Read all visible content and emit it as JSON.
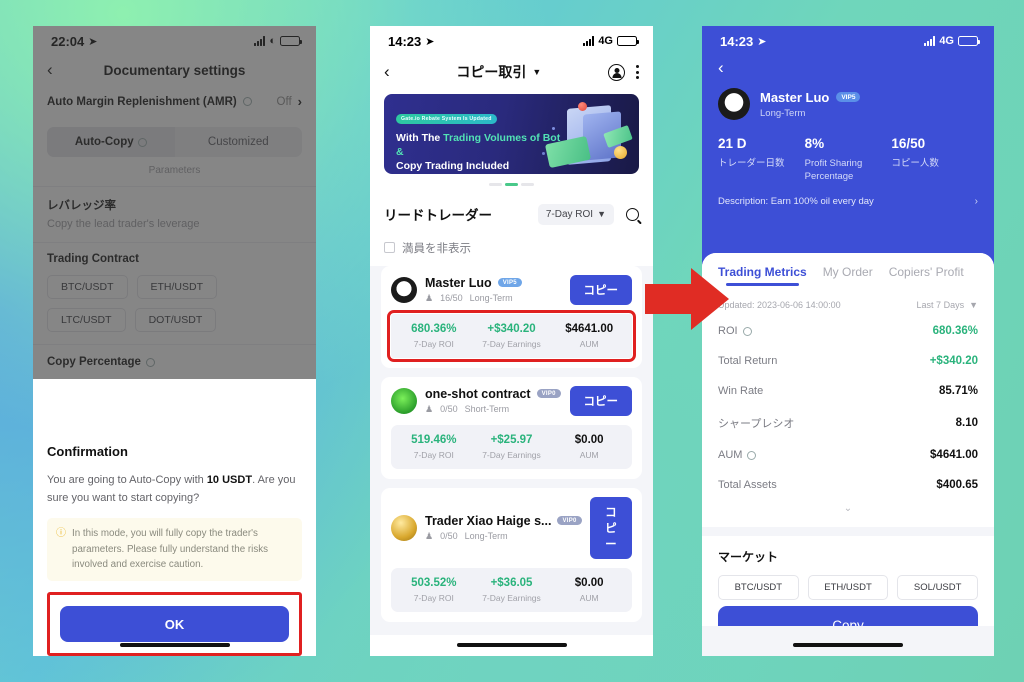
{
  "phone1": {
    "status": {
      "time": "22:04",
      "location_icon": "location-arrow",
      "network_icon": "signal-bars",
      "wifi_icon": "wifi",
      "battery_icon": "battery"
    },
    "nav": {
      "back_icon": "chevron-left",
      "title": "Documentary settings"
    },
    "amr": {
      "label": "Auto Margin Replenishment (AMR)",
      "info_icon": "info-circle",
      "value": "Off",
      "chevron_icon": "chevron-right"
    },
    "segments": [
      {
        "label": "Auto-Copy",
        "active": true,
        "info_icon": "info-circle"
      },
      {
        "label": "Customized",
        "active": false
      }
    ],
    "parameters_label": "Parameters",
    "leverage": {
      "title": "レバレッジ率",
      "subtitle": "Copy the lead trader's leverage"
    },
    "trading_contract": {
      "title": "Trading Contract",
      "chips": [
        "BTC/USDT",
        "ETH/USDT",
        "LTC/USDT",
        "DOT/USDT"
      ]
    },
    "copy_percentage": {
      "title": "Copy Percentage",
      "info_icon": "info-circle"
    },
    "confirmation": {
      "title": "Confirmation",
      "body_prefix": "You are going to Auto-Copy with ",
      "body_amount": "10 USDT",
      "body_suffix": ". Are you sure you want to start copying?",
      "warning_icon": "warning-icon",
      "warning": "In this mode, you will fully copy the trader's parameters. Please fully understand the risks involved and exercise caution.",
      "ok_label": "OK",
      "highlight_color": "#e02020",
      "button_color": "#3d4fd6"
    }
  },
  "phone2": {
    "status": {
      "time": "14:23",
      "location_icon": "location-arrow",
      "network_icon": "signal-bars",
      "network_label": "4G",
      "battery_icon": "battery"
    },
    "nav": {
      "back_icon": "chevron-left",
      "title": "コピー取引",
      "caret_icon": "caret-down",
      "account_icon": "user-circle-icon",
      "menu_icon": "kebab-menu-icon"
    },
    "banner": {
      "tag": "Gate.io Rebate System Is Updated",
      "line1_plain": "With The ",
      "line1_accent": "Trading Volumes of Bot &",
      "line2": "Copy Trading Included",
      "dots": 3,
      "active_dot": 2
    },
    "lead": {
      "title": "リードトレーダー",
      "sort_label": "7-Day ROI",
      "sort_caret": "caret-down",
      "search_icon": "search-icon"
    },
    "filter": {
      "checkbox_icon": "checkbox-unchecked",
      "label": "満員を非表示"
    },
    "stat_keys": [
      "7-Day ROI",
      "7-Day Earnings",
      "AUM"
    ],
    "traders": [
      {
        "avatar": "cow-avatar",
        "name": "Master Luo",
        "vip": "VIP5",
        "followers_icon": "person-icon",
        "followers": "16/50",
        "term": "Long-Term",
        "copy_label": "コピー",
        "roi": "680.36%",
        "earnings": "+$340.20",
        "aum": "$4641.00",
        "highlighted": true
      },
      {
        "avatar": "green-avatar",
        "name": "one-shot contract",
        "vip": "VIP0",
        "followers_icon": "person-icon",
        "followers": "0/50",
        "term": "Short-Term",
        "copy_label": "コピー",
        "roi": "519.46%",
        "earnings": "+$25.97",
        "aum": "$0.00",
        "highlighted": false
      },
      {
        "avatar": "gold-avatar",
        "name": "Trader Xiao Haige s...",
        "vip": "VIP0",
        "followers_icon": "person-icon",
        "followers": "0/50",
        "term": "Long-Term",
        "copy_label": "コピー",
        "roi": "503.52%",
        "earnings": "+$36.05",
        "aum": "$0.00",
        "highlighted": false
      }
    ]
  },
  "phone3": {
    "status": {
      "time": "14:23",
      "location_icon": "location-arrow",
      "network_icon": "signal-bars",
      "network_label": "4G",
      "battery_icon": "battery"
    },
    "back_icon": "chevron-left",
    "trader": {
      "avatar": "cow-avatar",
      "name": "Master Luo",
      "vip": "VIP5",
      "term": "Long-Term"
    },
    "kpis": [
      {
        "value": "21 D",
        "label": "トレーダー日数"
      },
      {
        "value": "8%",
        "label": "Profit Sharing Percentage"
      },
      {
        "value": "16/50",
        "label": "コピー人数"
      }
    ],
    "description": {
      "text": "Description: Earn 100% oil every day",
      "chevron_icon": "chevron-right"
    },
    "tabs": [
      {
        "label": "Trading Metrics",
        "active": true
      },
      {
        "label": "My Order",
        "active": false
      },
      {
        "label": "Copiers' Profit",
        "active": false
      }
    ],
    "updated": {
      "label": "Updated: 2023-06-06 14:00:00",
      "range": "Last 7 Days",
      "caret_icon": "caret-down"
    },
    "metrics": [
      {
        "key": "ROI",
        "info_icon": "info-circle",
        "value": "680.36%",
        "style": "green"
      },
      {
        "key": "Total Return",
        "info_icon": "",
        "value": "+$340.20",
        "style": "green"
      },
      {
        "key": "Win Rate",
        "info_icon": "",
        "value": "85.71%",
        "style": "dark"
      },
      {
        "key": "シャープレシオ",
        "info_icon": "",
        "value": "8.10",
        "style": "dark"
      },
      {
        "key": "AUM",
        "info_icon": "info-circle",
        "value": "$4641.00",
        "style": "dark"
      },
      {
        "key": "Total Assets",
        "info_icon": "",
        "value": "$400.65",
        "style": "dark"
      }
    ],
    "expand_icon": "chevron-down",
    "market": {
      "title": "マーケット",
      "chips": [
        "BTC/USDT",
        "ETH/USDT",
        "SOL/USDT"
      ]
    },
    "copy_label": "Copy",
    "accent_color": "#3d4fd6"
  },
  "annotation": {
    "arrow_icon": "right-arrow",
    "arrow_color": "#e02c24"
  }
}
